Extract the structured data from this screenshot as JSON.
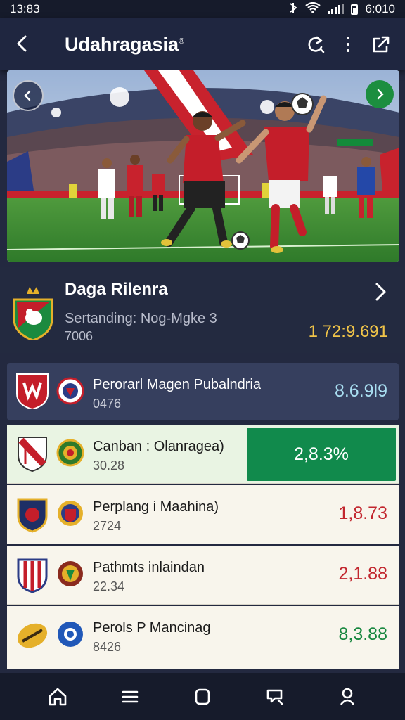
{
  "status": {
    "time_left": "13:83",
    "time_right": "6:010"
  },
  "appbar": {
    "title": "Udahragasia",
    "title_mark": "®"
  },
  "team": {
    "name": "Daga Rilenra",
    "subtitle": "Sertanding: Nog-Mgke 3",
    "code": "7006",
    "score": "1 72:9.691"
  },
  "matches": [
    {
      "name": "Perorarl Magen Pubalndria",
      "code": "0476",
      "odds": "8.6.9l9",
      "odds_color": "#a9def1"
    },
    {
      "name": "Canban : Olanragea)",
      "code": "30.28",
      "odds": "2,8.3%",
      "highlight": "#118a4c"
    },
    {
      "name": "Perplang i Maahina)",
      "code": "2724",
      "odds": "1,8.73",
      "odds_color": "#c2262e"
    },
    {
      "name": "Pathmts inlaindan",
      "code": "22.34",
      "odds": "2,1.88",
      "odds_color": "#c2262e"
    },
    {
      "name": "Perols P Mancinag",
      "code": "8426",
      "odds": "8,3.88",
      "odds_color": "#17873e"
    }
  ],
  "icons": {
    "back": "chevron-left-icon",
    "refresh": "refresh-icon",
    "more": "more-vertical-icon",
    "share": "share-icon",
    "home": "home-icon",
    "menu": "menu-icon",
    "square": "square-icon",
    "search": "search-icon",
    "profile": "profile-icon"
  },
  "colors": {
    "accent_gold": "#f0c449",
    "accent_green": "#118a4c",
    "odds_red": "#c2262e"
  }
}
